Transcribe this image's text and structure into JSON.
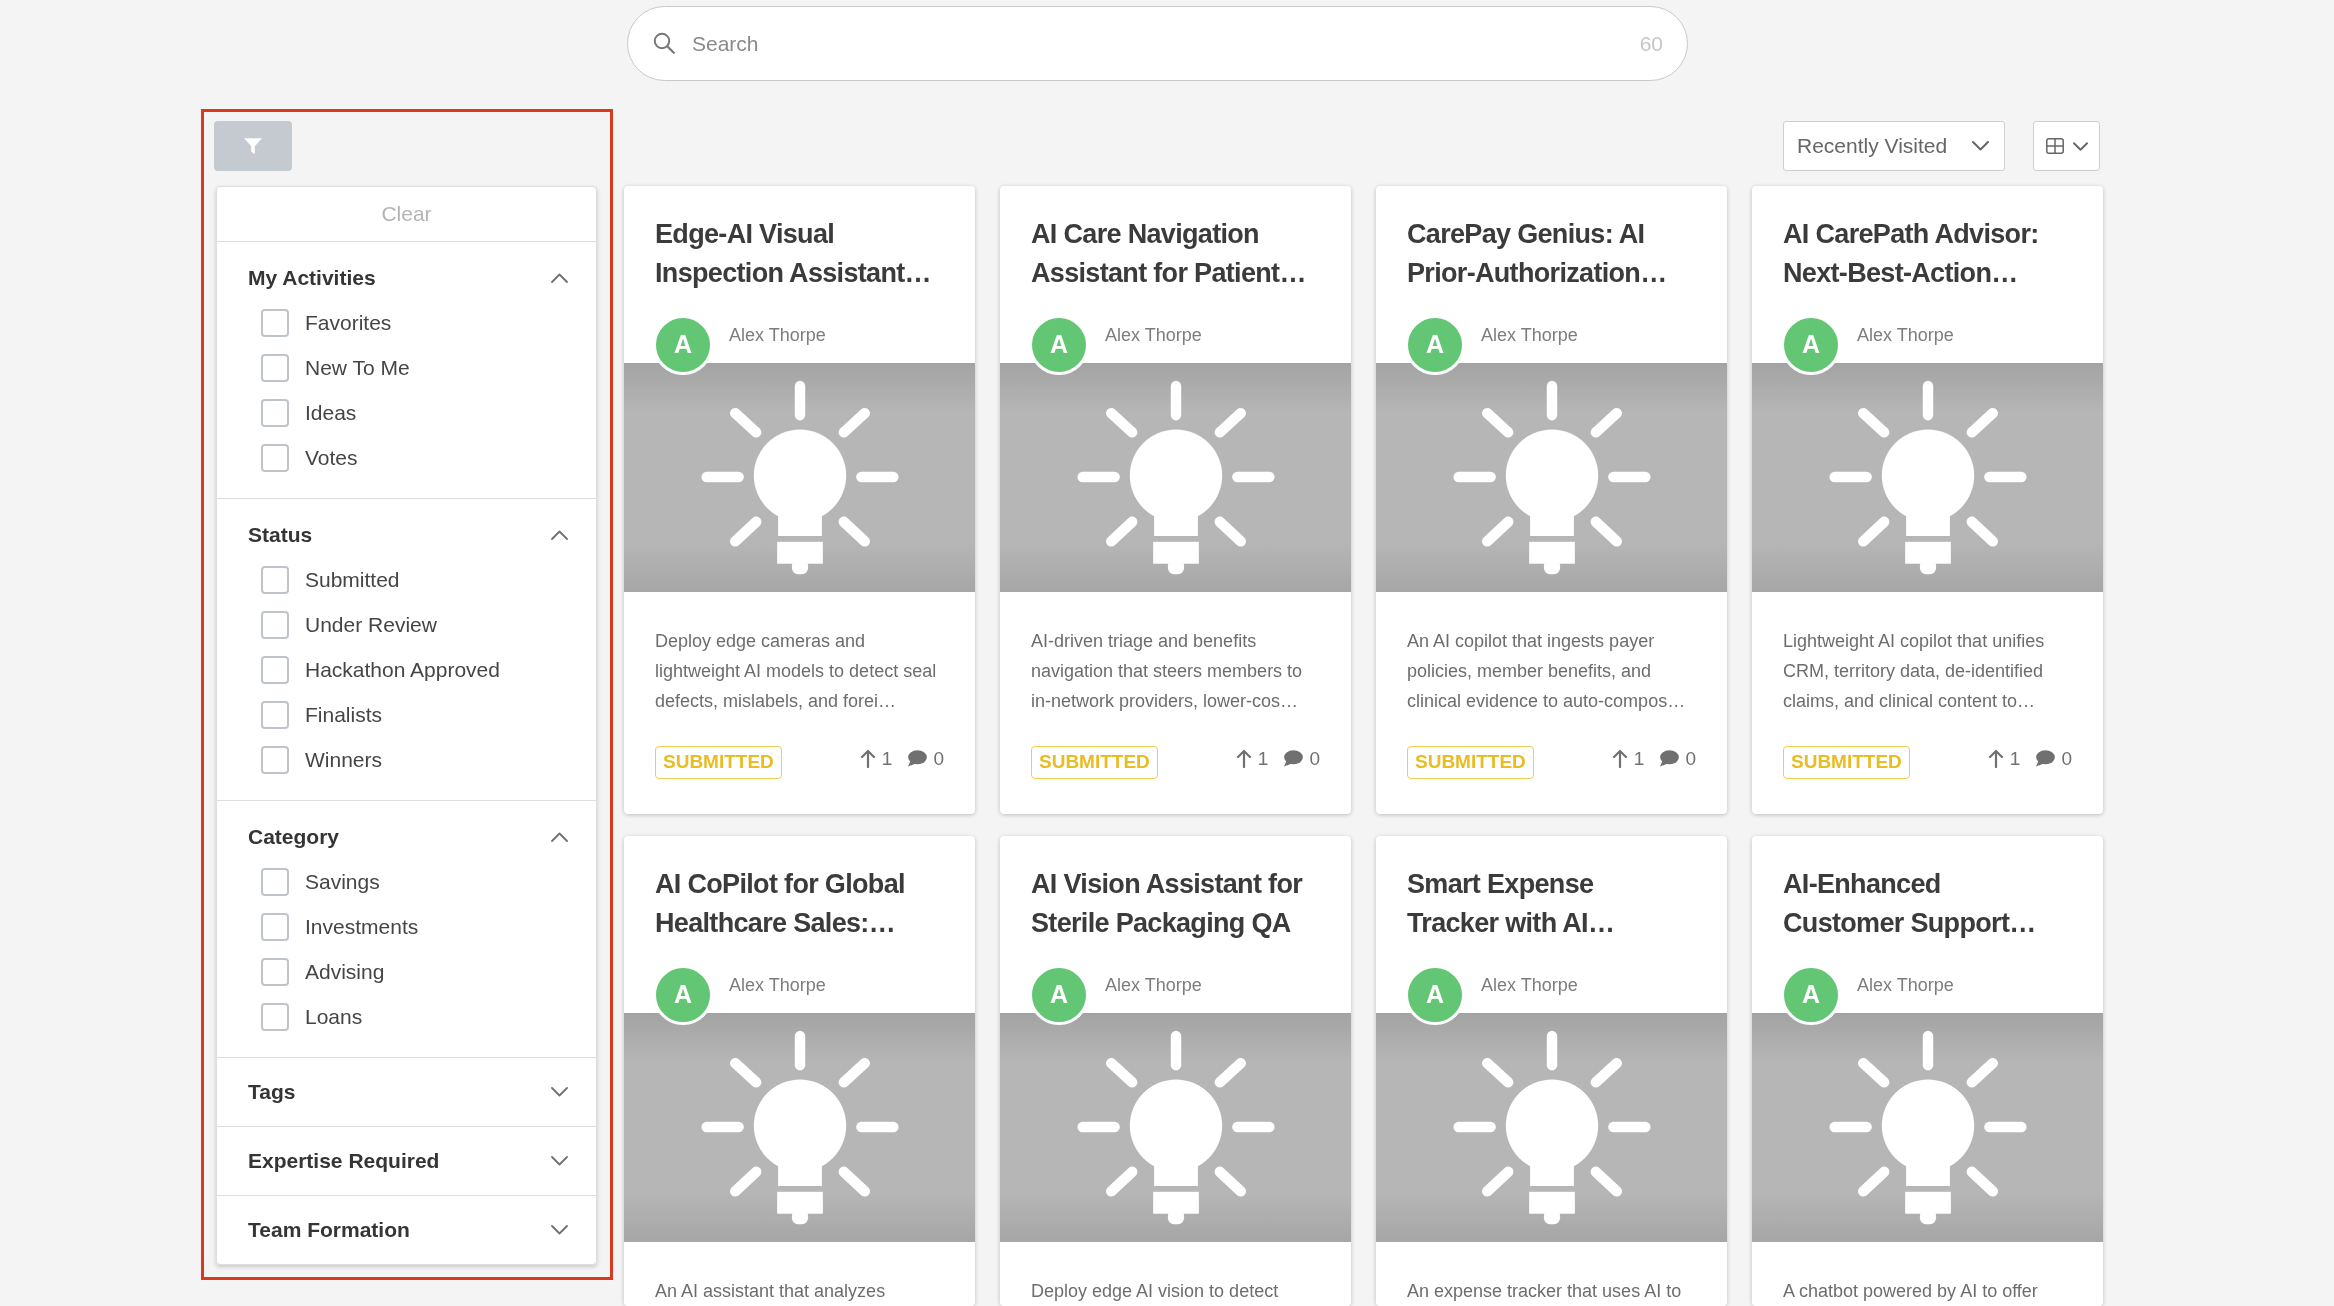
{
  "search": {
    "placeholder": "Search",
    "count": "60"
  },
  "filter_panel": {
    "highlighted": true,
    "clear_label": "Clear",
    "sections": [
      {
        "title": "My Activities",
        "expanded": true,
        "options": [
          {
            "label": "Favorites",
            "checked": false
          },
          {
            "label": "New To Me",
            "checked": false
          },
          {
            "label": "Ideas",
            "checked": false
          },
          {
            "label": "Votes",
            "checked": false
          }
        ]
      },
      {
        "title": "Status",
        "expanded": true,
        "options": [
          {
            "label": "Submitted",
            "checked": false
          },
          {
            "label": "Under Review",
            "checked": false
          },
          {
            "label": "Hackathon Approved",
            "checked": false
          },
          {
            "label": "Finalists",
            "checked": false
          },
          {
            "label": "Winners",
            "checked": false
          }
        ]
      },
      {
        "title": "Category",
        "expanded": true,
        "options": [
          {
            "label": "Savings",
            "checked": false
          },
          {
            "label": "Investments",
            "checked": false
          },
          {
            "label": "Advising",
            "checked": false
          },
          {
            "label": "Loans",
            "checked": false
          }
        ]
      },
      {
        "title": "Tags",
        "expanded": false
      },
      {
        "title": "Expertise Required",
        "expanded": false
      },
      {
        "title": "Team Formation",
        "expanded": false
      }
    ]
  },
  "sort": {
    "label": "Recently Visited"
  },
  "cards": [
    {
      "title": "Edge-AI Visual Inspection Assistant…",
      "author": "Alex Thorpe",
      "initial": "A",
      "description": "Deploy edge cameras and lightweight AI models to detect seal defects, mislabels, and forei…",
      "status": "SUBMITTED",
      "votes": "1",
      "comments": "0"
    },
    {
      "title": "AI Care Navigation Assistant for Patient…",
      "author": "Alex Thorpe",
      "initial": "A",
      "description": "AI-driven triage and benefits navigation that steers members to in-network providers, lower-cos…",
      "status": "SUBMITTED",
      "votes": "1",
      "comments": "0"
    },
    {
      "title": "CarePay Genius: AI Prior-Authorization…",
      "author": "Alex Thorpe",
      "initial": "A",
      "description": "An AI copilot that ingests payer policies, member benefits, and clinical evidence to auto-compos…",
      "status": "SUBMITTED",
      "votes": "1",
      "comments": "0"
    },
    {
      "title": "AI CarePath Advisor: Next-Best-Action…",
      "author": "Alex Thorpe",
      "initial": "A",
      "description": "Lightweight AI copilot that unifies CRM, territory data, de-identified claims, and clinical content to…",
      "status": "SUBMITTED",
      "votes": "1",
      "comments": "0"
    },
    {
      "title": "AI CoPilot for Global Healthcare Sales:…",
      "author": "Alex Thorpe",
      "initial": "A",
      "description": "An AI assistant that analyzes"
    },
    {
      "title": "AI Vision Assistant for Sterile Packaging QA",
      "author": "Alex Thorpe",
      "initial": "A",
      "description": "Deploy edge AI vision to detect"
    },
    {
      "title": "Smart Expense Tracker with AI…",
      "author": "Alex Thorpe",
      "initial": "A",
      "description": "An expense tracker that uses AI to"
    },
    {
      "title": "AI-Enhanced Customer Support…",
      "author": "Alex Thorpe",
      "initial": "A",
      "description": "A chatbot powered by AI to offer"
    }
  ]
}
